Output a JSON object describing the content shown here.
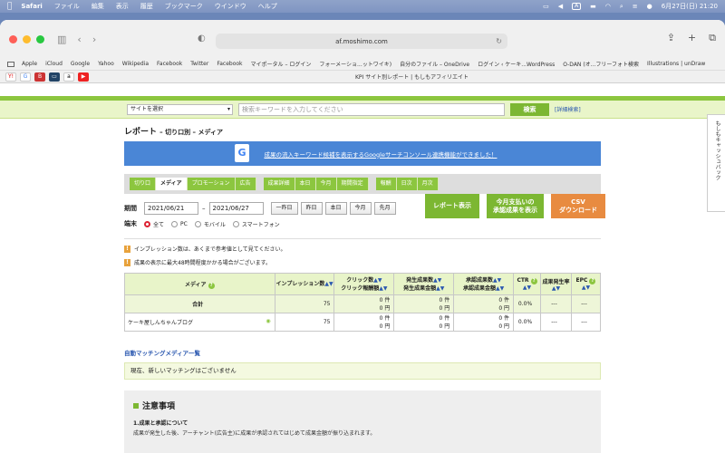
{
  "menubar": {
    "apple": "",
    "items": [
      "Safari",
      "ファイル",
      "編集",
      "表示",
      "履歴",
      "ブックマーク",
      "ウインドウ",
      "ヘルプ"
    ],
    "input_indicator": "A",
    "datetime": "6月27日(日)  21:20"
  },
  "browser": {
    "url": "af.moshimo.com",
    "bookmarks": [
      "Apple",
      "iCloud",
      "Google",
      "Yahoo",
      "Wikipedia",
      "Facebook",
      "Twitter",
      "Facebook",
      "マイポータル – ログイン",
      "フォーメーショ...ットワイキ)",
      "自分のファイル – OneDrive",
      "ログイン ‹ ケーキ...WordPress",
      "O-DAN (オ...フリーフォト検索",
      "Illustrations | unDraw"
    ],
    "tab_title": "KPI サイト別レポート | もしもアフィリエイト",
    "favicons": [
      "Y!",
      "G",
      "B",
      "▭",
      "a",
      "▶"
    ]
  },
  "search": {
    "site_select": "サイトを選択",
    "placeholder": "検索キーワードを入力してください",
    "button": "検索",
    "advanced": "[詳細検索]"
  },
  "side_tab": "もしもキャッシュバック",
  "report": {
    "title": "レポート",
    "subtitle": "– 切り口別 – メディア",
    "banner": "成果の流入キーワード候補を表示するGoogleサーチコンソール連携機能ができました！",
    "tabs_group1": [
      "切り口",
      "メディア",
      "プロモーション",
      "広告"
    ],
    "tabs_group2": [
      "成果詳細",
      "本日",
      "今月",
      "期間指定"
    ],
    "tabs_group3": [
      "報酬",
      "日次",
      "月次"
    ],
    "period_label": "期間",
    "date_from": "2021/06/21",
    "date_to": "2021/06/27",
    "period_buttons": [
      "一昨日",
      "昨日",
      "本日",
      "今月",
      "先月"
    ],
    "device_label": "端末",
    "devices": [
      "全て",
      "PC",
      "モバイル",
      "スマートフォン"
    ],
    "btn_report": "レポート表示",
    "btn_payment_line1": "今月支払いの",
    "btn_payment_line2": "承認成果を表示",
    "btn_csv_line1": "CSV",
    "btn_csv_line2": "ダウンロード",
    "note1": "インプレッション数は、あくまで参考値として見てください。",
    "note2": "成果の表示に最大48時間程度かかる場合がございます。"
  },
  "table": {
    "headers": {
      "media": "メディア",
      "impressions": "インプレッション数",
      "clicks_l1": "クリック数",
      "clicks_l2": "クリック報酬額",
      "occ_l1": "発生成果数",
      "occ_l2": "発生成果金額",
      "appr_l1": "承認成果数",
      "appr_l2": "承認成果金額",
      "ctr": "CTR",
      "rate": "成果発生率",
      "epc": "EPC"
    },
    "rows": [
      {
        "media": "合計",
        "impressions": "75",
        "clicks": "0 件",
        "click_reward": "0 円",
        "occ": "0 件",
        "occ_amount": "0 円",
        "appr": "0 件",
        "appr_amount": "0 円",
        "ctr": "0.0%",
        "rate": "---",
        "epc": "---"
      },
      {
        "media": "ケーキ屋しんちゃんブログ",
        "impressions": "75",
        "clicks": "0 件",
        "click_reward": "0 円",
        "occ": "0 件",
        "occ_amount": "0 円",
        "appr": "0 件",
        "appr_amount": "0 円",
        "ctr": "0.0%",
        "rate": "---",
        "epc": "---"
      }
    ]
  },
  "automatch": {
    "title": "自動マッチングメディア一覧",
    "empty": "現在、新しいマッチングはございません"
  },
  "notes": {
    "title": "注意事項",
    "sub": "1.成果と承認について",
    "text": "成果が発生した後、アーチャント(広告主)に成果が承認されてはじめて成果金額が振り込まれます。"
  }
}
